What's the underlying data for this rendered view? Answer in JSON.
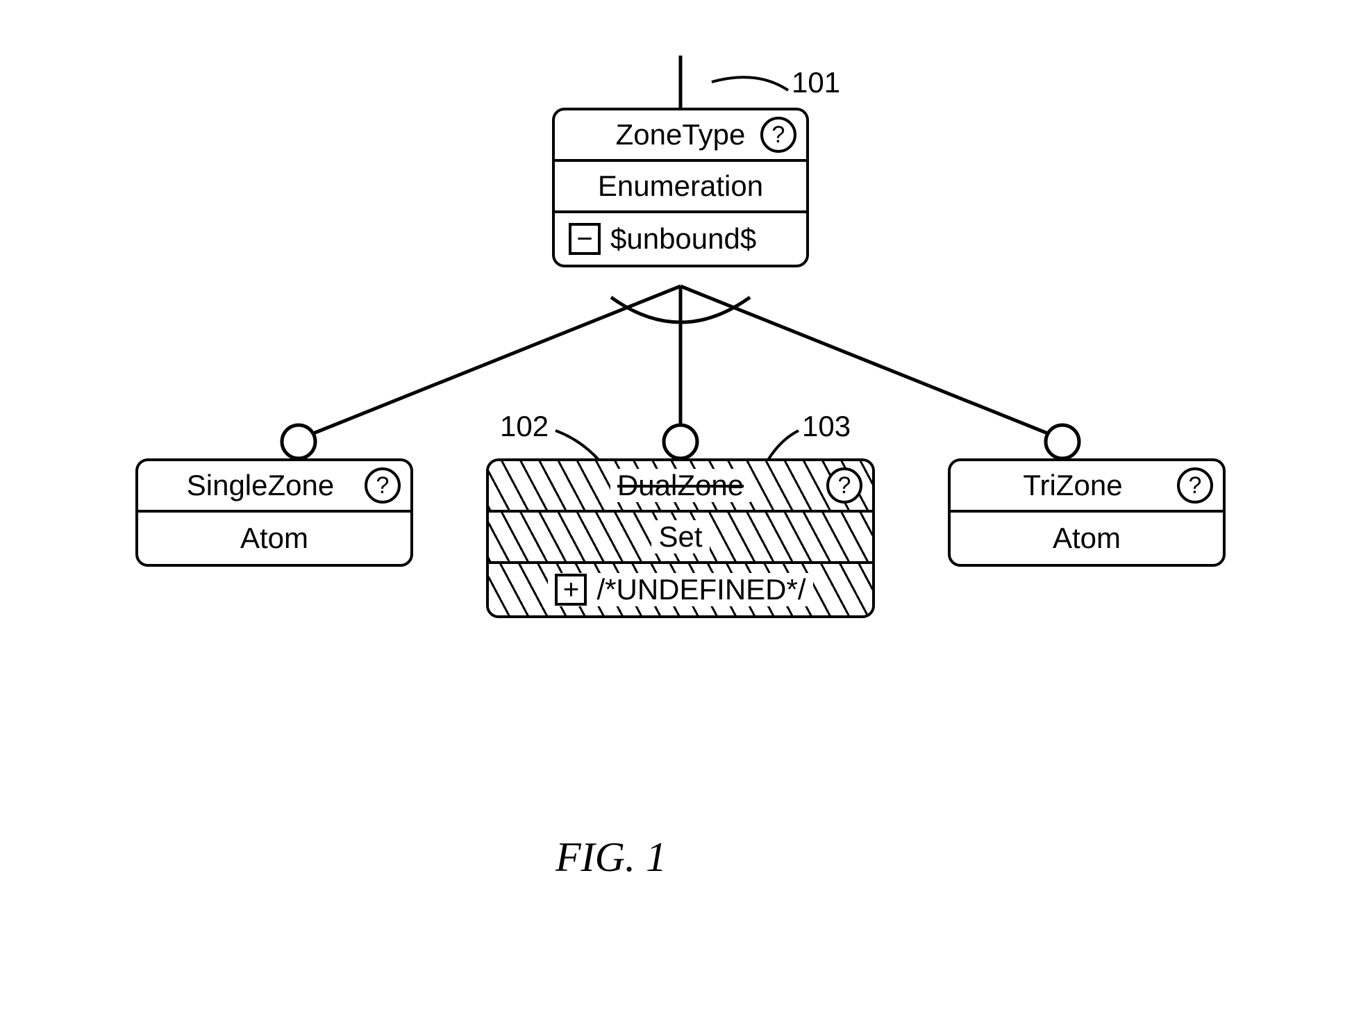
{
  "figure_label": "FIG.   1",
  "refs": {
    "r101": "101",
    "r102": "102",
    "r103": "103"
  },
  "parent": {
    "title": "ZoneType",
    "q": "?",
    "type": "Enumeration",
    "third_icon": "−",
    "third_text": "$unbound$"
  },
  "children": [
    {
      "title": "SingleZone",
      "q": "?",
      "type": "Atom"
    },
    {
      "title": "DualZone",
      "q": "?",
      "type": "Set",
      "third_icon": "+",
      "third_text": "/*UNDEFINED*/"
    },
    {
      "title": "TriZone",
      "q": "?",
      "type": "Atom"
    }
  ]
}
